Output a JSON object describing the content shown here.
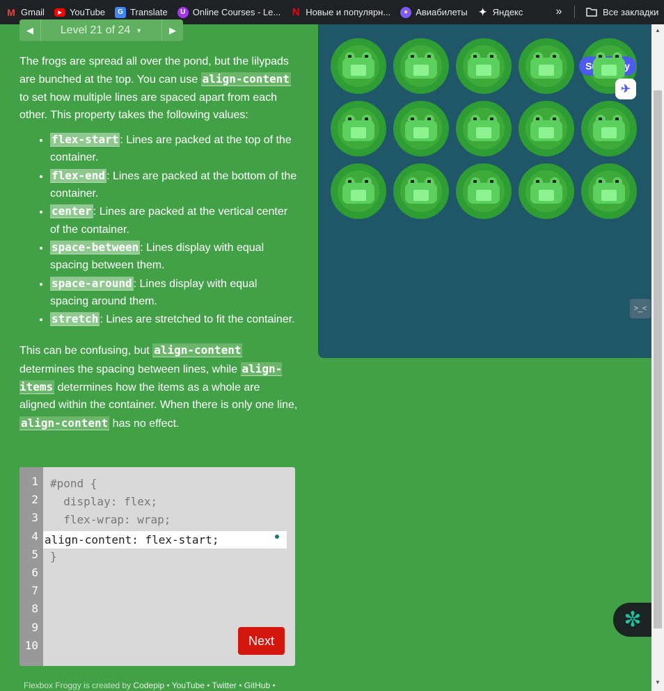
{
  "bookmarks": {
    "items": [
      {
        "label": "Gmail",
        "icon": "gmail-icon",
        "color": "#ea4335"
      },
      {
        "label": "YouTube",
        "icon": "youtube-icon",
        "color": "#ff0000"
      },
      {
        "label": "Translate",
        "icon": "translate-icon",
        "color": "#4285f4"
      },
      {
        "label": "Online Courses - Le...",
        "icon": "udemy-icon",
        "color": "#a435f0"
      },
      {
        "label": "Новые и популярн...",
        "icon": "netflix-icon",
        "color": "#e50914"
      },
      {
        "label": "Авиабилеты",
        "icon": "globe-icon",
        "color": "#7b5cff"
      },
      {
        "label": "Яндекс",
        "icon": "yandex-icon",
        "color": "#ffffff"
      }
    ],
    "more": "»",
    "all_bookmarks": "Все закладки"
  },
  "level_nav": {
    "prev": "◀",
    "label": "Level 21 of 24",
    "caret": "▼",
    "next": "▶"
  },
  "instructions": {
    "intro_1": "The frogs are spread all over the pond, but the lilypads are bunched at the top. You can use ",
    "intro_code": "align-content",
    "intro_2": " to set how multiple lines are spaced apart from each other. This property takes the following values:",
    "values": [
      {
        "code": "flex-start",
        "text": ": Lines are packed at the top of the container."
      },
      {
        "code": "flex-end",
        "text": ": Lines are packed at the bottom of the container."
      },
      {
        "code": "center",
        "text": ": Lines are packed at the vertical center of the container."
      },
      {
        "code": "space-between",
        "text": ": Lines display with equal spacing between them."
      },
      {
        "code": "space-around",
        "text": ": Lines display with equal spacing around them."
      },
      {
        "code": "stretch",
        "text": ": Lines are stretched to fit the container."
      }
    ],
    "outro_1": "This can be confusing, but ",
    "outro_code_1": "align-content",
    "outro_2": " determines the spacing between lines, while ",
    "outro_code_2": "align-items",
    "outro_3": " determines how the items as a whole are aligned within the container. When there is only one line, ",
    "outro_code_3": "align-content",
    "outro_4": " has no effect."
  },
  "editor": {
    "line_numbers": [
      "1",
      "2",
      "3",
      "4",
      "5",
      "6",
      "7",
      "8",
      "9",
      "10"
    ],
    "lines": [
      "#pond {",
      "  display: flex;",
      "  flex-wrap: wrap;",
      "",
      "}"
    ],
    "input_value": "align-content: flex-start;",
    "next_label": "Next"
  },
  "footer": {
    "prefix": "Flexbox Froggy is created by ",
    "links": [
      "Codepip",
      "YouTube",
      "Twitter",
      "GitHub"
    ],
    "separator": " • "
  },
  "pond": {
    "background": "#1f5768",
    "frog_count": 15,
    "summary_label": "Summary"
  },
  "widgets": {
    "side_icon": "bot-face-icon",
    "ai_icon": "openai-knot-icon"
  }
}
